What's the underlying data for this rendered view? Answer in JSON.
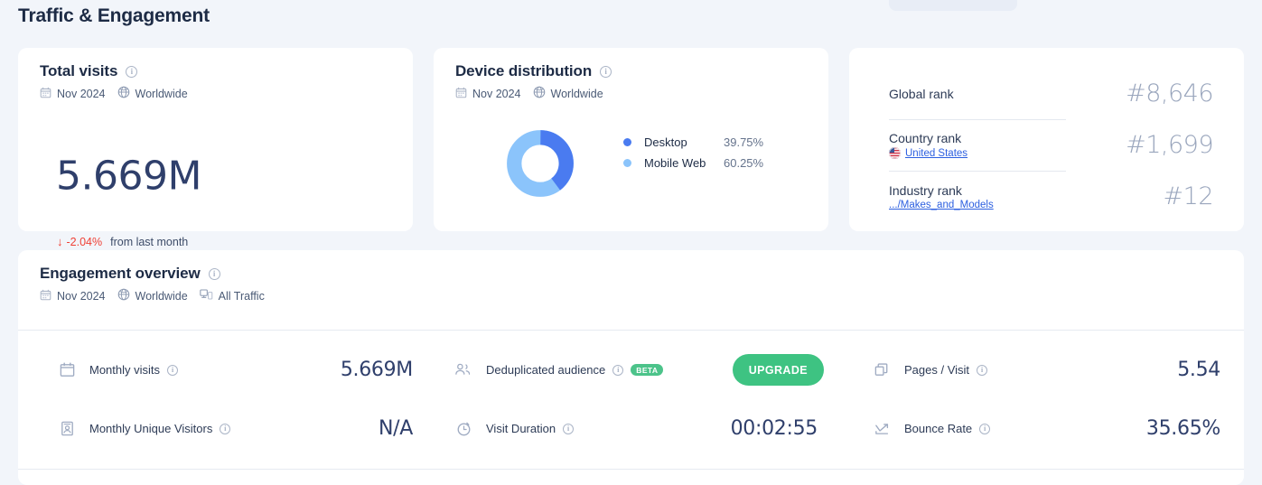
{
  "page": {
    "title": "Traffic & Engagement",
    "background_color": "#f2f5fa"
  },
  "total_visits": {
    "title": "Total visits",
    "info_icon": "info-icon",
    "date": "Nov 2024",
    "scope": "Worldwide",
    "value": "5.669M",
    "delta_arrow": "↓",
    "delta": "-2.04%",
    "delta_note": "from last month",
    "delta_color": "#ef4136"
  },
  "device_distribution": {
    "title": "Device distribution",
    "info_icon": "info-icon",
    "date": "Nov 2024",
    "scope": "Worldwide",
    "chart_data": {
      "type": "pie",
      "title": "Device distribution",
      "categories": [
        "Desktop",
        "Mobile Web"
      ],
      "values": [
        39.75,
        60.25
      ],
      "labels": [
        "39.75%",
        "60.25%"
      ],
      "colors": [
        "#4a7bf0",
        "#8bc4fb"
      ],
      "legend": "right",
      "donut": true
    },
    "legend": [
      {
        "label": "Desktop",
        "value": "39.75%",
        "color": "#4a7bf0"
      },
      {
        "label": "Mobile Web",
        "value": "60.25%",
        "color": "#8bc4fb"
      }
    ]
  },
  "ranks": [
    {
      "name": "Global rank",
      "value": "#8,646",
      "link": null,
      "flag": null
    },
    {
      "name": "Country rank",
      "value": "#1,699",
      "link": "United States",
      "flag": "us-flag-icon"
    },
    {
      "name": "Industry rank",
      "value": "#12",
      "link": ".../Makes_and_Models",
      "flag": null
    }
  ],
  "engagement": {
    "title": "Engagement overview",
    "info_icon": "info-icon",
    "date": "Nov 2024",
    "scope": "Worldwide",
    "traffic": "All Traffic",
    "metrics": [
      {
        "icon": "calendar-icon",
        "label": "Monthly visits",
        "value": "5.669M",
        "badge": null
      },
      {
        "icon": "users-icon",
        "label": "Deduplicated audience",
        "value": null,
        "badge": "BETA",
        "button": "UPGRADE",
        "button_color": "#3ec382"
      },
      {
        "icon": "pages-icon",
        "label": "Pages / Visit",
        "value": "5.54",
        "badge": null
      },
      {
        "icon": "visitor-icon",
        "label": "Monthly Unique Visitors",
        "value": "N/A",
        "badge": null
      },
      {
        "icon": "stopwatch-icon",
        "label": "Visit Duration",
        "value": "00:02:55",
        "badge": null
      },
      {
        "icon": "trend-icon",
        "label": "Bounce Rate",
        "value": "35.65%",
        "badge": null
      }
    ]
  }
}
